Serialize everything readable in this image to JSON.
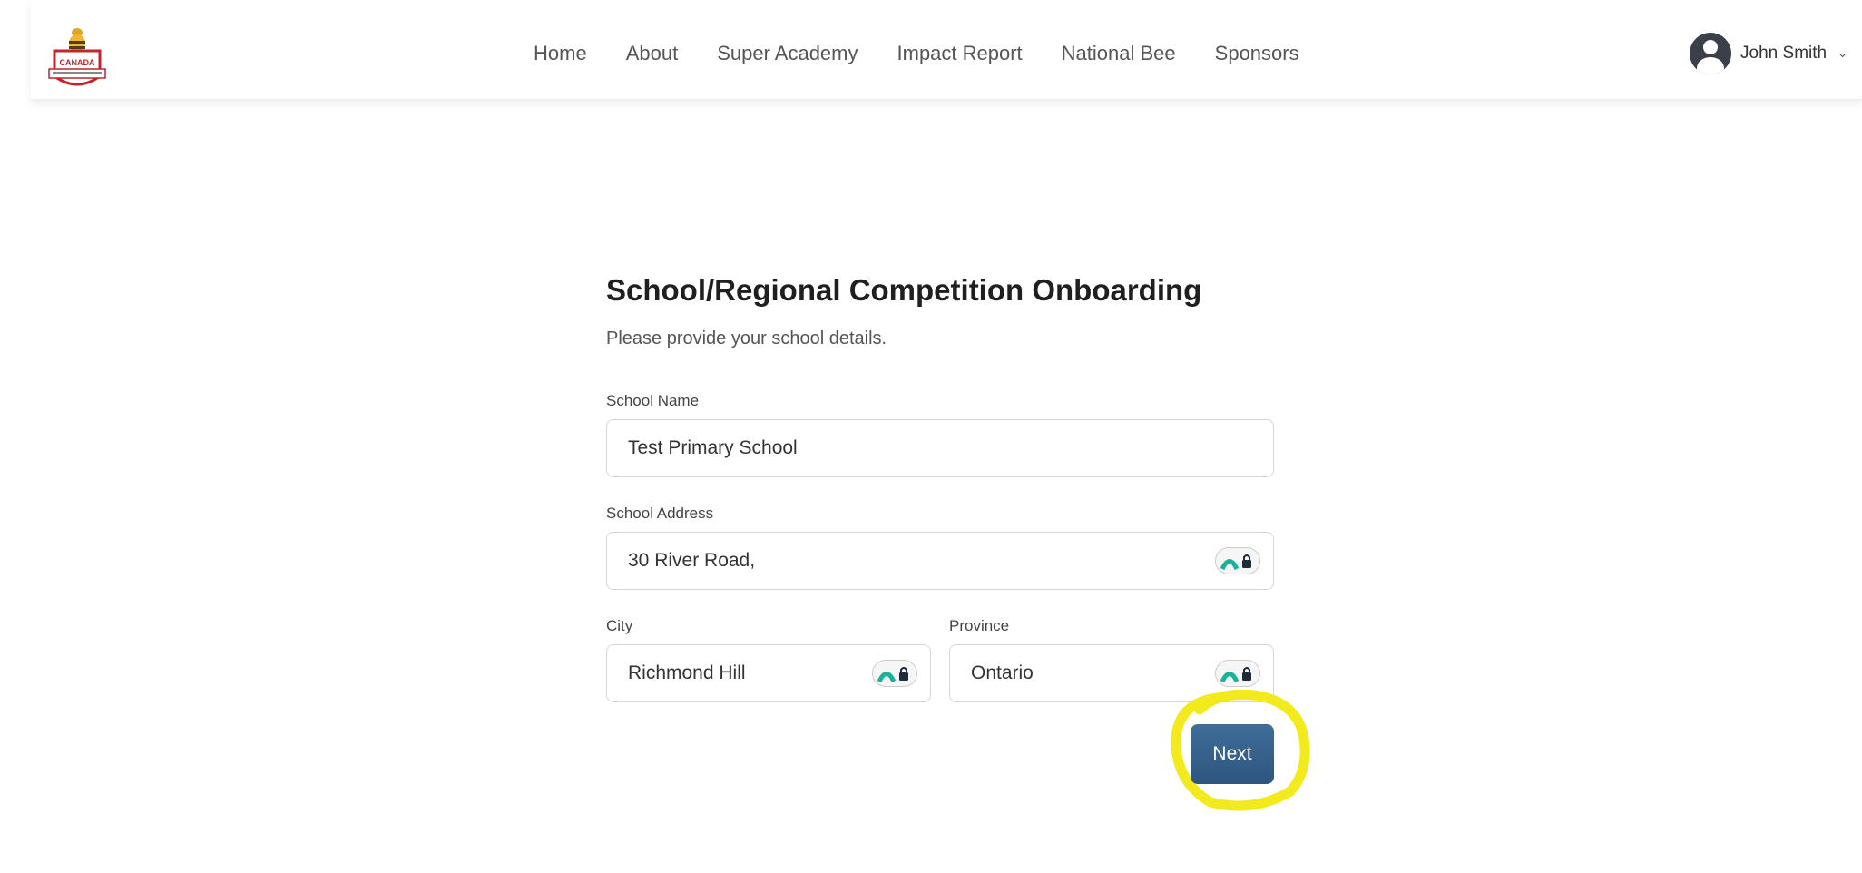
{
  "header": {
    "logo_text": "CANADA",
    "nav": [
      "Home",
      "About",
      "Super Academy",
      "Impact Report",
      "National Bee",
      "Sponsors"
    ],
    "user_name": "John Smith",
    "chevron": "⌄"
  },
  "form": {
    "title": "School/Regional Competition Onboarding",
    "subtitle": "Please provide your school details.",
    "school_name_label": "School Name",
    "school_name_value": "Test Primary School",
    "school_address_label": "School Address",
    "school_address_value": "30 River Road,",
    "city_label": "City",
    "city_value": "Richmond Hill",
    "province_label": "Province",
    "province_value": "Ontario",
    "next_label": "Next"
  },
  "colors": {
    "accent": "#2f5a86",
    "highlight": "#f2ea1c",
    "pm_teal": "#19b39a"
  }
}
